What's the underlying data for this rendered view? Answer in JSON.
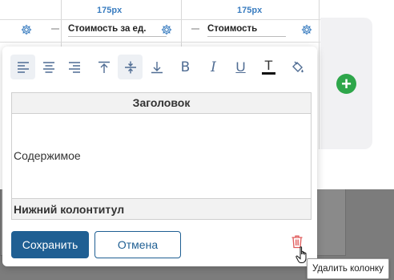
{
  "columns": [
    {
      "width_label": "",
      "title": "",
      "gear_icon": "gear-icon"
    },
    {
      "width_label": "175px",
      "title": "Стоимость за ед.",
      "gear_icon": "gear-icon"
    },
    {
      "width_label": "175px",
      "title": "Стоимость",
      "gear_icon": "gear-icon"
    }
  ],
  "add_column_icon": "plus-icon",
  "toolbar": {
    "buttons": [
      {
        "name": "align-left",
        "icon": "align-left-icon",
        "active": true
      },
      {
        "name": "align-center",
        "icon": "align-center-icon",
        "active": false
      },
      {
        "name": "align-right",
        "icon": "align-right-icon",
        "active": false
      },
      {
        "name": "valign-top",
        "icon": "valign-top-icon",
        "active": false
      },
      {
        "name": "valign-middle",
        "icon": "valign-middle-icon",
        "active": true
      },
      {
        "name": "valign-bottom",
        "icon": "valign-bottom-icon",
        "active": false
      },
      {
        "name": "bold",
        "label": "B",
        "active": false
      },
      {
        "name": "italic",
        "label": "I",
        "active": false
      },
      {
        "name": "underline",
        "label": "U",
        "active": false
      },
      {
        "name": "text-color",
        "label": "T",
        "active": false
      },
      {
        "name": "fill-color",
        "icon": "paint-bucket-icon",
        "active": false
      }
    ]
  },
  "preview": {
    "header": "Заголовок",
    "content": "Содержимое",
    "footer": "Нижний колонтитул"
  },
  "actions": {
    "save": "Сохранить",
    "cancel": "Отмена",
    "delete_tooltip": "Удалить колонку"
  },
  "colors": {
    "primary": "#1f5f93",
    "accent_blue": "#3a7dc0",
    "add_green": "#2ea64a",
    "delete_red": "#e05a5a"
  }
}
